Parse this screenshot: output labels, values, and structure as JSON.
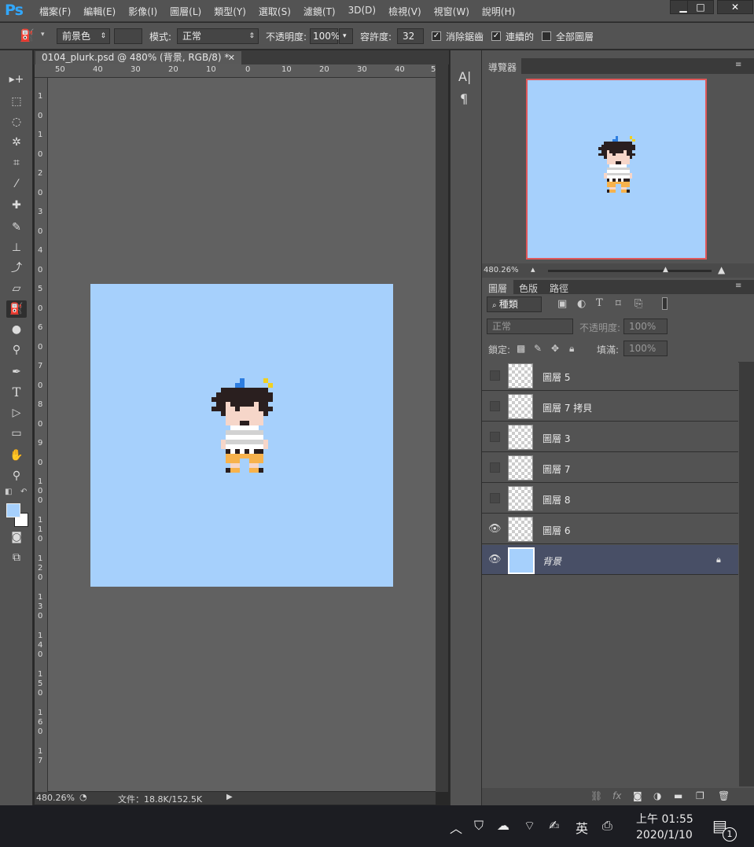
{
  "app": {
    "logo": "Ps"
  },
  "menu": [
    "檔案(F)",
    "編輯(E)",
    "影像(I)",
    "圖層(L)",
    "類型(Y)",
    "選取(S)",
    "濾鏡(T)",
    "3D(D)",
    "檢視(V)",
    "視窗(W)",
    "說明(H)"
  ],
  "window_buttons": {
    "minimize": "▁",
    "maximize": "□",
    "close": "✕"
  },
  "options": {
    "fill_source": "前景色",
    "mode_label": "模式:",
    "mode_value": "正常",
    "opacity_label": "不透明度:",
    "opacity_value": "100%",
    "tolerance_label": "容許度:",
    "tolerance_value": "32",
    "antialias_label": "消除鋸齒",
    "contiguous_label": "連續的",
    "all_layers_label": "全部圖層"
  },
  "document": {
    "tab_title": "0104_plurk.psd @ 480% (背景, RGB/8) *",
    "zoom": "480.26%",
    "file_info": "文件：18.8K/152.5K",
    "bg_color": "#a6d0fc",
    "ruler_h": [
      "50",
      "40",
      "30",
      "20",
      "10",
      "0",
      "10",
      "20",
      "30",
      "40",
      "5"
    ],
    "ruler_v": [
      "1",
      "0",
      "1",
      "0",
      "2",
      "0",
      "3",
      "0",
      "4",
      "0",
      "5",
      "0",
      "6",
      "0",
      "7",
      "0",
      "8",
      "0",
      "9",
      "0",
      "1\n0\n0",
      "1\n1\n0",
      "1\n2\n0",
      "1\n3\n0",
      "1\n4\n0",
      "1\n5\n0",
      "1\n6\n0",
      "1\n7"
    ]
  },
  "navigator": {
    "title": "導覽器",
    "zoom": "480.26%"
  },
  "panel_tabs": [
    "圖層",
    "色版",
    "路徑"
  ],
  "layers_panel": {
    "filter_kind": "種類",
    "blend_mode": "正常",
    "opacity_label": "不透明度:",
    "opacity_value": "100%",
    "lock_label": "鎖定:",
    "fill_label": "填滿:",
    "fill_value": "100%",
    "layers": [
      {
        "name": "圖層 5",
        "visible": false
      },
      {
        "name": "圖層 7 拷貝",
        "visible": false
      },
      {
        "name": "圖層 3",
        "visible": false
      },
      {
        "name": "圖層 7",
        "visible": false
      },
      {
        "name": "圖層 8",
        "visible": false
      },
      {
        "name": "圖層 6",
        "visible": true
      },
      {
        "name": "背景",
        "visible": true,
        "locked": true,
        "selected": true
      }
    ]
  },
  "taskbar": {
    "ime": "英",
    "time": "上午 01:55",
    "date": "2020/1/10",
    "notif_count": "1"
  },
  "colors": {
    "foreground": "#a6d0fc",
    "background": "#ffffff"
  }
}
